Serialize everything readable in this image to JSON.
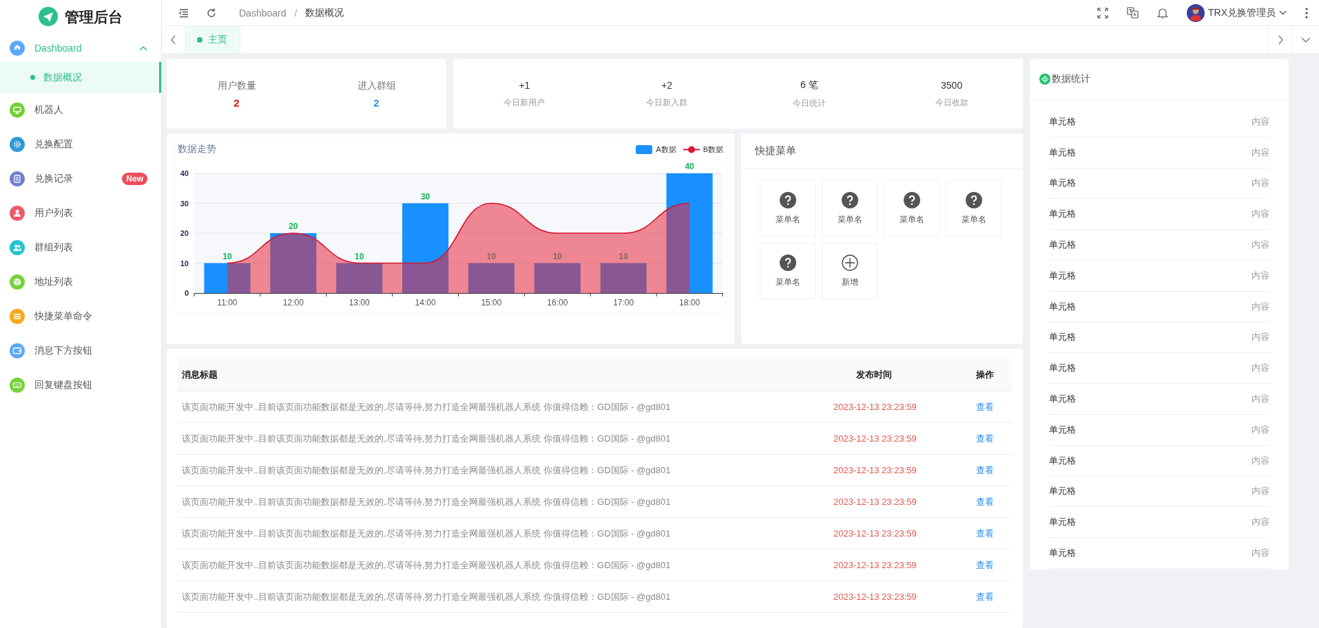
{
  "sidebar": {
    "logo": "管理后台",
    "items": [
      {
        "label": "Dashboard",
        "color": "#5aa9f8",
        "expanded": true,
        "selected": true,
        "children": [
          {
            "label": "数据概况",
            "selected": true
          }
        ]
      },
      {
        "label": "机器人",
        "color": "#6fd02f",
        "selected": false
      },
      {
        "label": "兑换配置",
        "color": "#2d9ad8",
        "selected": false
      },
      {
        "label": "兑换记录",
        "color": "#6f7fd0",
        "selected": false,
        "badge": "New"
      },
      {
        "label": "用户列表",
        "color": "#ef5a6a",
        "selected": false
      },
      {
        "label": "群组列表",
        "color": "#25c4d0",
        "selected": false
      },
      {
        "label": "地址列表",
        "color": "#76d23a",
        "selected": false
      },
      {
        "label": "快捷菜单命令",
        "color": "#f7a91c",
        "selected": false
      },
      {
        "label": "消息下方按钮",
        "color": "#5aa9f8",
        "selected": false
      },
      {
        "label": "回复键盘按钮",
        "color": "#76d23a",
        "selected": false
      }
    ]
  },
  "header": {
    "breadcrumb": [
      "Dashboard",
      "数据概况"
    ],
    "separator": "/",
    "user": "TRX兑换管理员"
  },
  "tabs": [
    {
      "label": "主页",
      "selected": true
    }
  ],
  "stats_left": [
    {
      "label": "用户数量",
      "value": "2",
      "color": "#e01010"
    },
    {
      "label": "进入群组",
      "value": "2",
      "color": "#2f8ff0"
    }
  ],
  "stats_right": [
    {
      "value": "+1",
      "label": "今日新用户"
    },
    {
      "value": "+2",
      "label": "今日新入群"
    },
    {
      "value": "6 笔",
      "label": "今日统计"
    },
    {
      "value": "3500",
      "label": "今日收款"
    }
  ],
  "trend": {
    "chart_data": {
      "type": "bar",
      "title": "数据走势",
      "categories": [
        "11:00",
        "12:00",
        "13:00",
        "14:00",
        "15:00",
        "16:00",
        "17:00",
        "18:00"
      ],
      "ylim": [
        0,
        40
      ],
      "yticks": [
        0,
        10,
        20,
        30,
        40
      ],
      "grid": true,
      "legend": "top-right",
      "value_labels": [
        [
          "10",
          "20",
          "10",
          "30",
          "10",
          "10",
          "10",
          "40"
        ],
        [
          null,
          null,
          null,
          null,
          null,
          null,
          null,
          null
        ]
      ],
      "series": [
        {
          "name": "A数据",
          "color": "#1890ff",
          "type": "bar",
          "values": [
            10,
            20,
            10,
            30,
            10,
            10,
            10,
            40
          ]
        },
        {
          "name": "B数据",
          "color": "#d9162f",
          "type": "area",
          "values": [
            10,
            20,
            10,
            10,
            30,
            20,
            20,
            30
          ]
        }
      ]
    }
  },
  "quick_menu": {
    "title": "快捷菜单",
    "items": [
      {
        "label": "菜单名",
        "kind": "help"
      },
      {
        "label": "菜单名",
        "kind": "help"
      },
      {
        "label": "菜单名",
        "kind": "help"
      },
      {
        "label": "菜单名",
        "kind": "help"
      },
      {
        "label": "菜单名",
        "kind": "help"
      },
      {
        "label": "新增",
        "kind": "add"
      }
    ]
  },
  "messages": {
    "columns": [
      "消息标题",
      "发布时间",
      "操作"
    ],
    "rows": [
      {
        "title": "该页面功能开发中..目前该页面功能数据都是无效的,尽请等待,努力打造全网最强机器人系统 你值得信赖：GD国际 - @gd801",
        "time": "2023-12-13 23:23:59",
        "action": "查看"
      },
      {
        "title": "该页面功能开发中..目前该页面功能数据都是无效的,尽请等待,努力打造全网最强机器人系统 你值得信赖：GD国际 - @gd801",
        "time": "2023-12-13 23:23:59",
        "action": "查看"
      },
      {
        "title": "该页面功能开发中..目前该页面功能数据都是无效的,尽请等待,努力打造全网最强机器人系统 你值得信赖：GD国际 - @gd801",
        "time": "2023-12-13 23:23:59",
        "action": "查看"
      },
      {
        "title": "该页面功能开发中..目前该页面功能数据都是无效的,尽请等待,努力打造全网最强机器人系统 你值得信赖：GD国际 - @gd801",
        "time": "2023-12-13 23:23:59",
        "action": "查看"
      },
      {
        "title": "该页面功能开发中..目前该页面功能数据都是无效的,尽请等待,努力打造全网最强机器人系统 你值得信赖：GD国际 - @gd801",
        "time": "2023-12-13 23:23:59",
        "action": "查看"
      },
      {
        "title": "该页面功能开发中..目前该页面功能数据都是无效的,尽请等待,努力打造全网最强机器人系统 你值得信赖：GD国际 - @gd801",
        "time": "2023-12-13 23:23:59",
        "action": "查看"
      },
      {
        "title": "该页面功能开发中..目前该页面功能数据都是无效的,尽请等待,努力打造全网最强机器人系统 你值得信赖：GD国际 - @gd801",
        "time": "2023-12-13 23:23:59",
        "action": "查看"
      }
    ]
  },
  "stats_panel": {
    "title": "数据统计",
    "rows": [
      {
        "label": "单元格",
        "value": "内容"
      },
      {
        "label": "单元格",
        "value": "内容"
      },
      {
        "label": "单元格",
        "value": "内容"
      },
      {
        "label": "单元格",
        "value": "内容"
      },
      {
        "label": "单元格",
        "value": "内容"
      },
      {
        "label": "单元格",
        "value": "内容"
      },
      {
        "label": "单元格",
        "value": "内容"
      },
      {
        "label": "单元格",
        "value": "内容"
      },
      {
        "label": "单元格",
        "value": "内容"
      },
      {
        "label": "单元格",
        "value": "内容"
      },
      {
        "label": "单元格",
        "value": "内容"
      },
      {
        "label": "单元格",
        "value": "内容"
      },
      {
        "label": "单元格",
        "value": "内容"
      },
      {
        "label": "单元格",
        "value": "内容"
      },
      {
        "label": "单元格",
        "value": "内容"
      }
    ]
  }
}
